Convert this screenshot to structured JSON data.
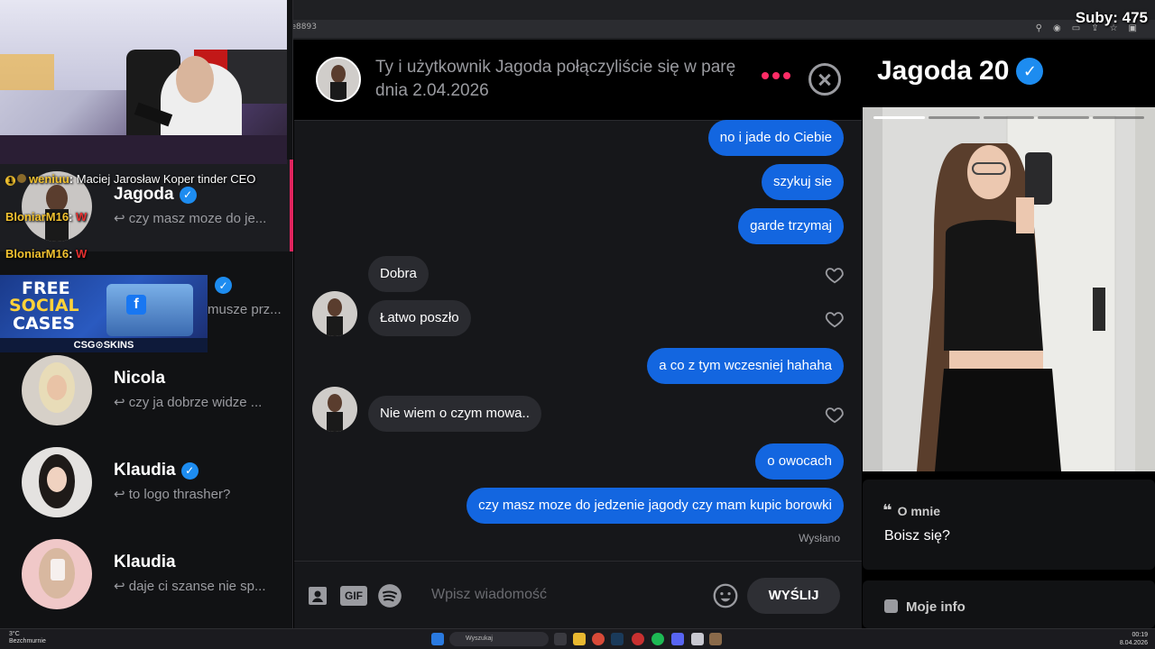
{
  "stream": {
    "subs": "Suby: 475",
    "url_fragment": "le8893"
  },
  "chat": [
    {
      "user": "weniuu",
      "text": "Maciej Jarosław Koper tinder CEO"
    },
    {
      "user": "BloniarM16",
      "text": "W"
    },
    {
      "user": "BloniarM16",
      "text": "W"
    }
  ],
  "promo": {
    "line1": "FREE",
    "line2": "SOCIAL",
    "line3": "CASES",
    "brand": "CSG⊙SKINS"
  },
  "matches": [
    {
      "name": "Jagoda",
      "verified": true,
      "last_message": "czy masz moze do je..."
    },
    {
      "name": "",
      "verified": true,
      "last_message": "musze prz..."
    },
    {
      "name": "Nicola",
      "verified": false,
      "last_message": "czy ja dobrze widze ..."
    },
    {
      "name": "Klaudia",
      "verified": true,
      "last_message": "to logo thrasher?"
    },
    {
      "name": "Klaudia",
      "verified": false,
      "last_message": "daje ci szanse nie sp..."
    }
  ],
  "conversation": {
    "header_text": "Ty i użytkownik Jagoda połączyliście się w parę dnia 2.04.2026",
    "messages": [
      {
        "dir": "out",
        "text": "no i jade do Ciebie"
      },
      {
        "dir": "out",
        "text": "szykuj sie"
      },
      {
        "dir": "out",
        "text": "garde trzymaj"
      },
      {
        "dir": "in",
        "text": "Dobra"
      },
      {
        "dir": "in",
        "text": "Łatwo poszło"
      },
      {
        "dir": "out",
        "text": "a co z tym wczesniej hahaha"
      },
      {
        "dir": "in",
        "text": "Nie wiem o czym mowa.."
      },
      {
        "dir": "out",
        "text": "o owocach"
      },
      {
        "dir": "out",
        "text": "czy  masz moze do jedzenie jagody czy mam kupic borowki"
      }
    ],
    "sent_label": "Wysłano",
    "composer": {
      "placeholder": "Wpisz wiadomość",
      "gif_label": "GIF",
      "send_label": "WYŚLIJ"
    }
  },
  "profile": {
    "name": "Jagoda",
    "age": "20",
    "about_heading": "O mnie",
    "about_text": "Boisz się?",
    "info_heading": "Moje info",
    "photo_count": 5,
    "active_photo_index": 1
  },
  "taskbar": {
    "weather_temp": "3°C",
    "weather_desc": "Bezchmurnie",
    "search_placeholder": "Wyszukaj",
    "time": "00:19",
    "date": "8.04.2026"
  },
  "colors": {
    "accent_pink": "#ff2c66",
    "sent_bubble": "#1366e0",
    "verified": "#1d8cf0"
  }
}
